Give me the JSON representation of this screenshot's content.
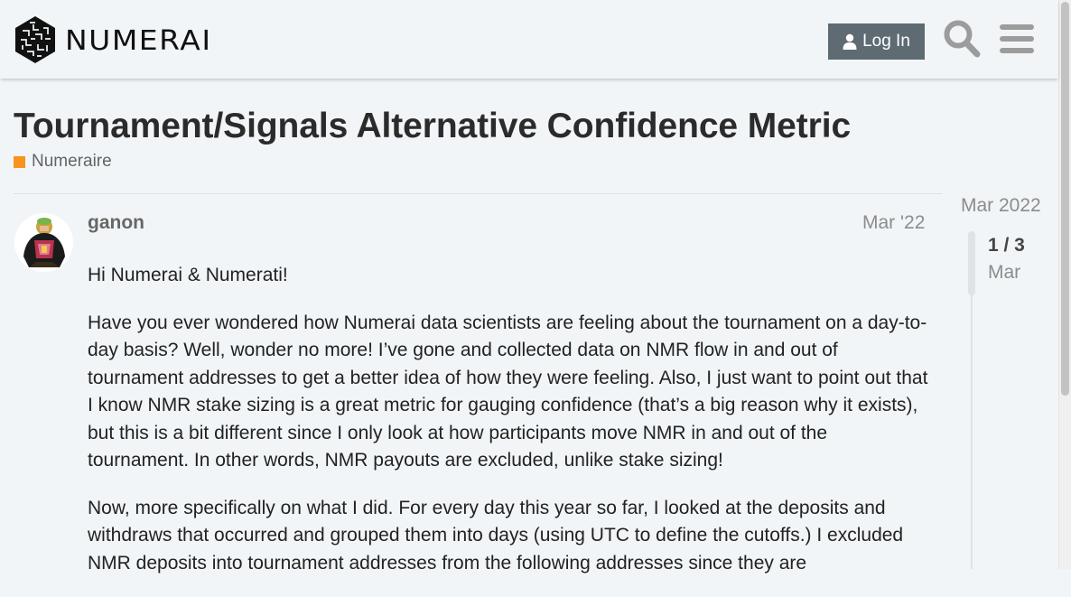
{
  "header": {
    "brand": "NUMERAI",
    "login_label": "Log In",
    "icons": {
      "login": "user-icon",
      "search": "search-icon",
      "menu": "hamburger-menu-icon"
    }
  },
  "topic": {
    "title": "Tournament/Signals Alternative Confidence Metric",
    "category": {
      "name": "Numeraire",
      "color": "#f7941d"
    }
  },
  "post": {
    "username": "ganon",
    "date": "Mar '22",
    "paragraphs": [
      "Hi Numerai & Numerati!",
      "Have you ever wondered how Numerai data scientists are feeling about the tournament on a day-to-day basis? Well, wonder no more! I’ve gone and collected data on NMR flow in and out of tournament addresses to get a better idea of how they were feeling. Also, I just want to point out that I know NMR stake sizing is a great metric for gauging confidence (that’s a big reason why it exists), but this is a bit different since I only look at how participants move NMR in and out of the tournament. In other words, NMR payouts are excluded, unlike stake sizing!",
      "Now, more specifically on what I did. For every day this year so far, I looked at the deposits and withdraws that occurred and grouped them into days (using UTC to define the cutoffs.) I excluded NMR deposits into tournament addresses from the following addresses since they are"
    ]
  },
  "timeline": {
    "start_date": "Mar 2022",
    "position": "1 / 3",
    "current_date": "Mar"
  },
  "colors": {
    "background": "#f2f5f7",
    "login_button": "#5f6b73",
    "category_badge": "#f7941d"
  }
}
